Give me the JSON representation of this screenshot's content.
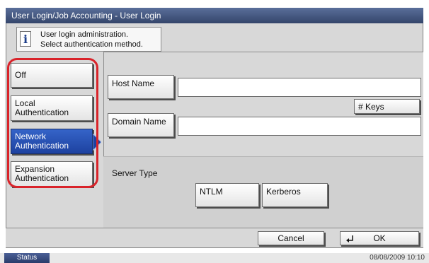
{
  "title": "User Login/Job Accounting - User Login",
  "message": {
    "line1": "User login administration.",
    "line2": "Select authentication method."
  },
  "auth_methods": [
    {
      "line1": "Off",
      "line2": "",
      "selected": false
    },
    {
      "line1": "Local",
      "line2": "Authentication",
      "selected": false
    },
    {
      "line1": "Network",
      "line2": "Authentication",
      "selected": true
    },
    {
      "line1": "Expansion",
      "line2": "Authentication",
      "selected": false
    }
  ],
  "host_name_label": "Host Name",
  "host_name_value": "",
  "keys_label": "# Keys",
  "domain_name_label": "Domain Name",
  "domain_name_value": "",
  "server_type_label": "Server Type",
  "server_types": [
    "NTLM",
    "Kerberos"
  ],
  "cancel_label": "Cancel",
  "ok_label": "OK",
  "status_label": "Status",
  "datetime": "08/08/2009   10:10",
  "colors": {
    "accent": "#1d42a0",
    "highlight": "#d9232a",
    "title_bar": "#3e5180"
  },
  "icons": {
    "info": "info-icon",
    "enter": "enter-icon",
    "arrow": "selection-arrow-icon"
  }
}
